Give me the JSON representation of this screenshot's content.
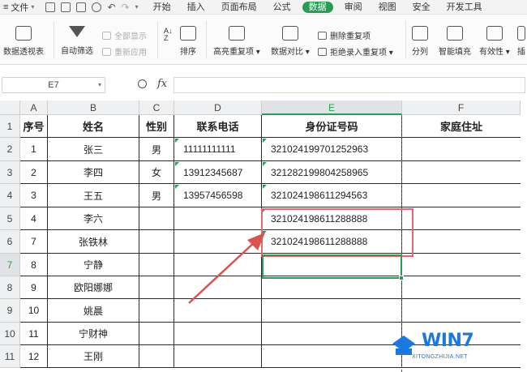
{
  "menubar": {
    "file_label": "文件",
    "tabs": [
      {
        "label": "开始",
        "active": false
      },
      {
        "label": "插入",
        "active": false
      },
      {
        "label": "页面布局",
        "active": false
      },
      {
        "label": "公式",
        "active": false
      },
      {
        "label": "数据",
        "active": true
      },
      {
        "label": "审阅",
        "active": false
      },
      {
        "label": "视图",
        "active": false
      },
      {
        "label": "安全",
        "active": false
      },
      {
        "label": "开发工具",
        "active": false
      }
    ]
  },
  "ribbon": {
    "pivot": "数据透视表",
    "autofilter": "自动筛选",
    "show_all": "全部显示",
    "reapply": "重新应用",
    "sort": "排序",
    "highlight_dup": "高亮重复项",
    "compare": "数据对比",
    "delete_dup": "删除重复项",
    "reject_dup": "拒绝录入重复项",
    "split": "分列",
    "smart_fill": "智能填充",
    "validity": "有效性",
    "insert": "插"
  },
  "formula_bar": {
    "name_box": "E7",
    "fx": "fx",
    "formula": ""
  },
  "columns": [
    "A",
    "B",
    "C",
    "D",
    "E",
    "F"
  ],
  "selected_column": "E",
  "selected_row": "7",
  "rows": [
    {
      "num": "1",
      "cells": [
        "序号",
        "姓名",
        "性别",
        "联系电话",
        "身份证号码",
        "家庭住址"
      ]
    },
    {
      "num": "2",
      "cells": [
        "1",
        "张三",
        "男",
        "11111111111",
        "321024199701252963",
        ""
      ]
    },
    {
      "num": "3",
      "cells": [
        "2",
        "李四",
        "女",
        "13912345687",
        "321282199804258965",
        ""
      ]
    },
    {
      "num": "4",
      "cells": [
        "3",
        "王五",
        "男",
        "13957456598",
        "321024198611294563",
        ""
      ]
    },
    {
      "num": "5",
      "cells": [
        "4",
        "李六",
        "",
        "",
        "321024198611288888",
        ""
      ]
    },
    {
      "num": "6",
      "cells": [
        "7",
        "张铁林",
        "",
        "",
        "321024198611288888",
        ""
      ]
    },
    {
      "num": "7",
      "cells": [
        "8",
        "宁静",
        "",
        "",
        "",
        ""
      ]
    },
    {
      "num": "8",
      "cells": [
        "9",
        "欧阳娜娜",
        "",
        "",
        "",
        ""
      ]
    },
    {
      "num": "9",
      "cells": [
        "10",
        "姚晨",
        "",
        "",
        "",
        ""
      ]
    },
    {
      "num": "10",
      "cells": [
        "11",
        "宁财神",
        "",
        "",
        "",
        ""
      ]
    },
    {
      "num": "11",
      "cells": [
        "12",
        "王刚",
        "",
        "",
        "",
        ""
      ]
    }
  ],
  "watermark": {
    "text": "WIN7",
    "sub": "XITONGZHIJIA.NET"
  },
  "colors": {
    "accent": "#2a9d55",
    "highlight_box": "#e06a6a",
    "arrow": "#d9534f",
    "watermark": "#1b78e0"
  }
}
